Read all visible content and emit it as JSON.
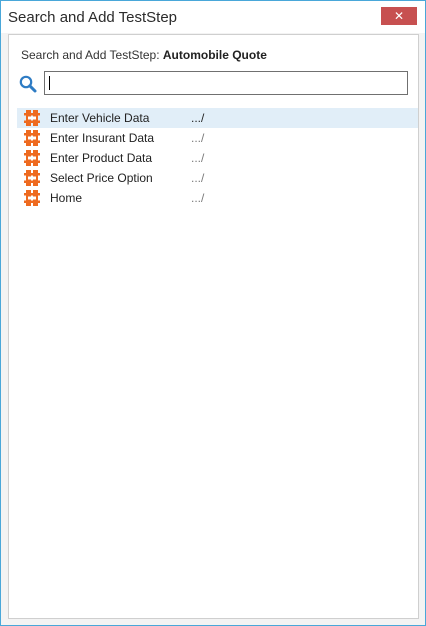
{
  "window": {
    "title": "Search and Add TestStep",
    "close_glyph": "✕"
  },
  "header": {
    "prefix": "Search and Add TestStep: ",
    "project_name": "Automobile Quote"
  },
  "search": {
    "value": "",
    "icon": "search-icon"
  },
  "colors": {
    "accent": "#49a7d9",
    "close_button": "#c75050",
    "selection": "#e1eef8",
    "module_icon": "#ee6a1f"
  },
  "results": [
    {
      "name": "Enter Vehicle Data",
      "path": ".../",
      "selected": true,
      "icon": "module-icon"
    },
    {
      "name": "Enter Insurant Data",
      "path": ".../",
      "selected": false,
      "icon": "module-icon"
    },
    {
      "name": "Enter Product Data",
      "path": ".../",
      "selected": false,
      "icon": "module-icon"
    },
    {
      "name": "Select Price Option",
      "path": ".../",
      "selected": false,
      "icon": "module-icon"
    },
    {
      "name": "Home",
      "path": ".../",
      "selected": false,
      "icon": "module-icon"
    }
  ]
}
